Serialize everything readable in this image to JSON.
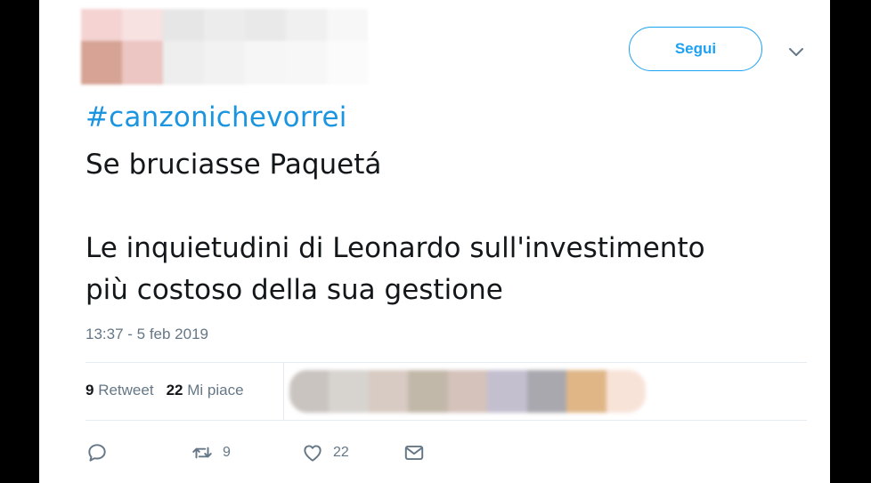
{
  "tweet": {
    "hashtag": "#canzonichevorrei",
    "line1": "Se bruciasse Paquetá",
    "line2": "Le inquietudini di Leonardo sull'investimento\npiù costoso della sua gestione",
    "timestamp": "13:37 - 5 feb 2019"
  },
  "header": {
    "follow_label": "Segui",
    "menu_icon": "chevron-down-icon"
  },
  "stats": {
    "retweets_count": "9",
    "retweets_label": "Retweet",
    "likes_count": "22",
    "likes_label": "Mi piace"
  },
  "actions": {
    "reply_icon": "reply-icon",
    "retweet_icon": "retweet-icon",
    "retweet_count": "9",
    "like_icon": "heart-icon",
    "like_count": "22",
    "message_icon": "envelope-icon"
  },
  "colors": {
    "accent": "#1da1f2",
    "link": "#1b95e0",
    "text": "#14171a",
    "muted": "#657786"
  }
}
